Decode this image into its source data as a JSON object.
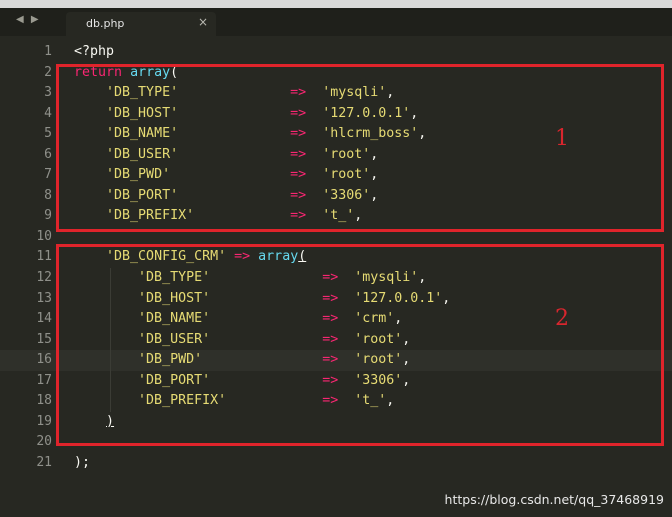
{
  "tab": {
    "filename": "db.php",
    "close_glyph": "×",
    "nav_icons": "◀ ▶"
  },
  "code_lines": [
    {
      "n": "1",
      "tokens": [
        [
          "t",
          "<?php"
        ]
      ]
    },
    {
      "n": "2",
      "tokens": [
        [
          "k",
          "return"
        ],
        [
          "t",
          " "
        ],
        [
          "b",
          "array"
        ],
        [
          "t",
          "("
        ]
      ]
    },
    {
      "n": "3",
      "tokens": [
        [
          "t",
          "    "
        ],
        [
          "s",
          "'DB_TYPE'"
        ],
        [
          "t",
          "              "
        ],
        [
          "k",
          "=>"
        ],
        [
          "t",
          "  "
        ],
        [
          "s",
          "'mysqli'"
        ],
        [
          "t",
          ","
        ]
      ]
    },
    {
      "n": "4",
      "tokens": [
        [
          "t",
          "    "
        ],
        [
          "s",
          "'DB_HOST'"
        ],
        [
          "t",
          "              "
        ],
        [
          "k",
          "=>"
        ],
        [
          "t",
          "  "
        ],
        [
          "s",
          "'127.0.0.1'"
        ],
        [
          "t",
          ","
        ]
      ]
    },
    {
      "n": "5",
      "tokens": [
        [
          "t",
          "    "
        ],
        [
          "s",
          "'DB_NAME'"
        ],
        [
          "t",
          "              "
        ],
        [
          "k",
          "=>"
        ],
        [
          "t",
          "  "
        ],
        [
          "s",
          "'hlcrm_boss'"
        ],
        [
          "t",
          ","
        ]
      ]
    },
    {
      "n": "6",
      "tokens": [
        [
          "t",
          "    "
        ],
        [
          "s",
          "'DB_USER'"
        ],
        [
          "t",
          "              "
        ],
        [
          "k",
          "=>"
        ],
        [
          "t",
          "  "
        ],
        [
          "s",
          "'root'"
        ],
        [
          "t",
          ","
        ]
      ]
    },
    {
      "n": "7",
      "tokens": [
        [
          "t",
          "    "
        ],
        [
          "s",
          "'DB_PWD'"
        ],
        [
          "t",
          "               "
        ],
        [
          "k",
          "=>"
        ],
        [
          "t",
          "  "
        ],
        [
          "s",
          "'root'"
        ],
        [
          "t",
          ","
        ]
      ]
    },
    {
      "n": "8",
      "tokens": [
        [
          "t",
          "    "
        ],
        [
          "s",
          "'DB_PORT'"
        ],
        [
          "t",
          "              "
        ],
        [
          "k",
          "=>"
        ],
        [
          "t",
          "  "
        ],
        [
          "s",
          "'3306'"
        ],
        [
          "t",
          ","
        ]
      ]
    },
    {
      "n": "9",
      "tokens": [
        [
          "t",
          "    "
        ],
        [
          "s",
          "'DB_PREFIX'"
        ],
        [
          "t",
          "            "
        ],
        [
          "k",
          "=>"
        ],
        [
          "t",
          "  "
        ],
        [
          "s",
          "'t_'"
        ],
        [
          "t",
          ","
        ]
      ]
    },
    {
      "n": "10",
      "tokens": []
    },
    {
      "n": "11",
      "tokens": [
        [
          "t",
          "    "
        ],
        [
          "s",
          "'DB_CONFIG_CRM'"
        ],
        [
          "t",
          " "
        ],
        [
          "k",
          "=>"
        ],
        [
          "t",
          " "
        ],
        [
          "b",
          "array"
        ],
        [
          "u",
          "("
        ]
      ]
    },
    {
      "n": "12",
      "tokens": [
        [
          "t",
          "        "
        ],
        [
          "s",
          "'DB_TYPE'"
        ],
        [
          "t",
          "              "
        ],
        [
          "k",
          "=>"
        ],
        [
          "t",
          "  "
        ],
        [
          "s",
          "'mysqli'"
        ],
        [
          "t",
          ","
        ]
      ]
    },
    {
      "n": "13",
      "tokens": [
        [
          "t",
          "        "
        ],
        [
          "s",
          "'DB_HOST'"
        ],
        [
          "t",
          "              "
        ],
        [
          "k",
          "=>"
        ],
        [
          "t",
          "  "
        ],
        [
          "s",
          "'127.0.0.1'"
        ],
        [
          "t",
          ","
        ]
      ]
    },
    {
      "n": "14",
      "tokens": [
        [
          "t",
          "        "
        ],
        [
          "s",
          "'DB_NAME'"
        ],
        [
          "t",
          "              "
        ],
        [
          "k",
          "=>"
        ],
        [
          "t",
          "  "
        ],
        [
          "s",
          "'crm'"
        ],
        [
          "t",
          ","
        ]
      ]
    },
    {
      "n": "15",
      "tokens": [
        [
          "t",
          "        "
        ],
        [
          "s",
          "'DB_USER'"
        ],
        [
          "t",
          "              "
        ],
        [
          "k",
          "=>"
        ],
        [
          "t",
          "  "
        ],
        [
          "s",
          "'root'"
        ],
        [
          "t",
          ","
        ]
      ]
    },
    {
      "n": "16",
      "tokens": [
        [
          "t",
          "        "
        ],
        [
          "s",
          "'DB_PWD'"
        ],
        [
          "t",
          "               "
        ],
        [
          "k",
          "=>"
        ],
        [
          "t",
          "  "
        ],
        [
          "s",
          "'root'"
        ],
        [
          "t",
          ","
        ]
      ],
      "active": true
    },
    {
      "n": "17",
      "tokens": [
        [
          "t",
          "        "
        ],
        [
          "s",
          "'DB_PORT'"
        ],
        [
          "t",
          "              "
        ],
        [
          "k",
          "=>"
        ],
        [
          "t",
          "  "
        ],
        [
          "s",
          "'3306'"
        ],
        [
          "t",
          ","
        ]
      ]
    },
    {
      "n": "18",
      "tokens": [
        [
          "t",
          "        "
        ],
        [
          "s",
          "'DB_PREFIX'"
        ],
        [
          "t",
          "            "
        ],
        [
          "k",
          "=>"
        ],
        [
          "t",
          "  "
        ],
        [
          "s",
          "'t_'"
        ],
        [
          "t",
          ","
        ]
      ]
    },
    {
      "n": "19",
      "tokens": [
        [
          "t",
          "    "
        ],
        [
          "u",
          ")"
        ]
      ]
    },
    {
      "n": "20",
      "tokens": []
    },
    {
      "n": "21",
      "tokens": [
        [
          "t",
          ");"
        ]
      ]
    }
  ],
  "annotations": {
    "box1": "1",
    "box2": "2"
  },
  "watermark": "https://blog.csdn.net/qq_37468919",
  "colors": {
    "background": "#272822",
    "keyword": "#f92672",
    "string": "#e6db74",
    "builtin": "#66d9ef",
    "annotation": "#e0242b"
  }
}
